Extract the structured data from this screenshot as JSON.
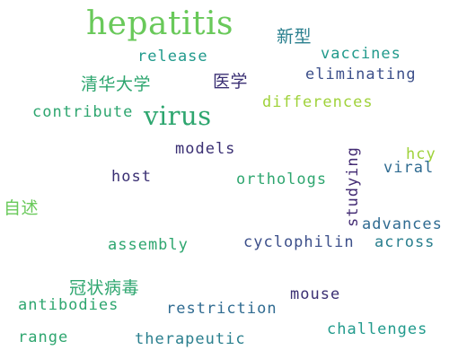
{
  "colors": {
    "background": "#ffffff",
    "light_green": "#69c95a",
    "yellow_green": "#9fd23a",
    "green": "#2ea66f",
    "teal": "#219a8c",
    "teal_blue": "#2a7f8e",
    "blue": "#2f6b91",
    "slate": "#3c4f8a",
    "navy": "#3a2f73",
    "indigo": "#442c74"
  },
  "words": {
    "hepatitis": "hepatitis",
    "virus": "virus",
    "release": "release",
    "vaccines": "vaccines",
    "eliminating": "eliminating",
    "differences": "differences",
    "contribute": "contribute",
    "models": "models",
    "host": "host",
    "orthologs": "orthologs",
    "viral": "viral",
    "hcy": "hcy",
    "studying": "studying",
    "advances": "advances",
    "assembly": "assembly",
    "cyclophilin": "cyclophilin",
    "across": "across",
    "mouse": "mouse",
    "antibodies": "antibodies",
    "restriction": "restriction",
    "challenges": "challenges",
    "range": "range",
    "therapeutic": "therapeutic",
    "xinxing": "新型",
    "qinghua": "清华大学",
    "yixue": "医学",
    "zishu": "自述",
    "guanzhuang": "冠状病毒"
  }
}
